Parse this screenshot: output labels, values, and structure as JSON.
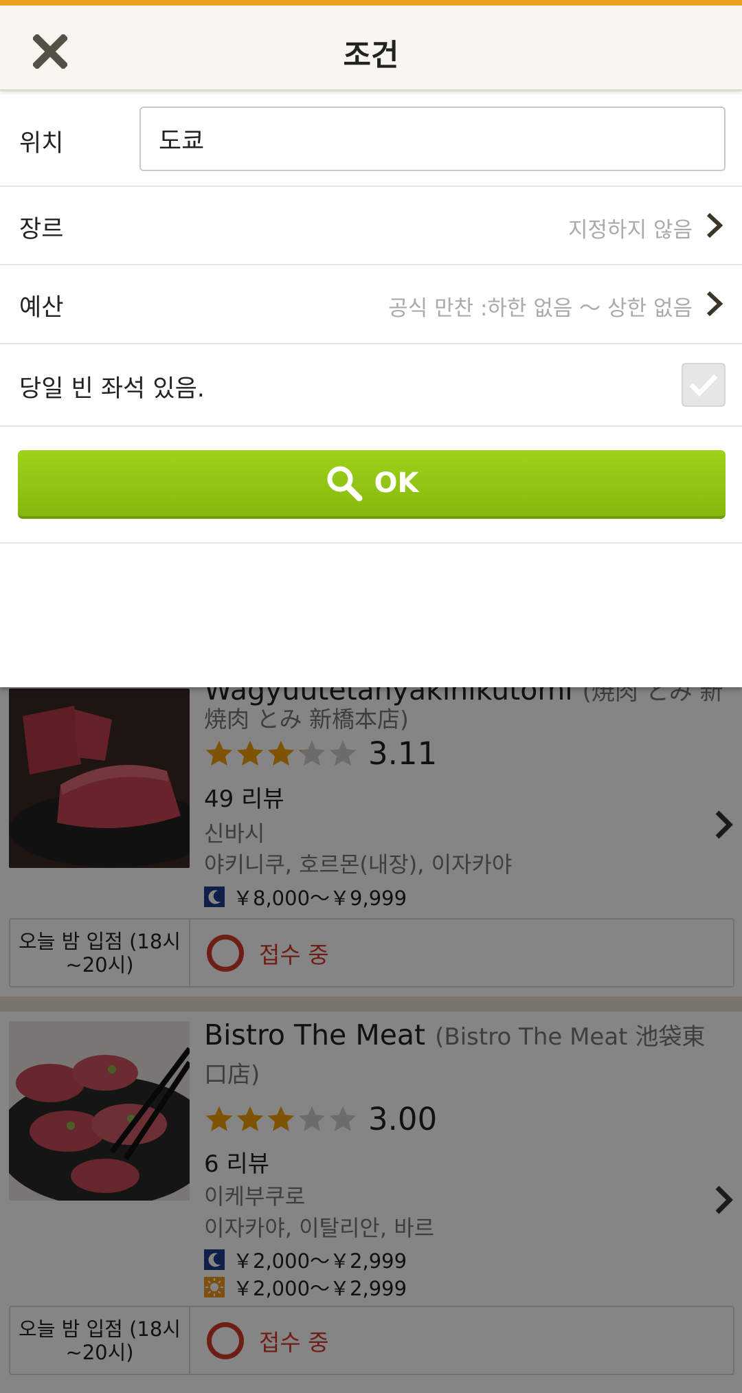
{
  "header": {
    "title": "조건"
  },
  "filters": {
    "location": {
      "label": "위치",
      "value": "도쿄"
    },
    "genre": {
      "label": "장르",
      "value": "지정하지 않음"
    },
    "budget": {
      "label": "예산",
      "value": "공식 만찬 :하한 없음 ～ 상한 없음"
    },
    "vacancy": {
      "label": "당일 빈 좌석 있음.",
      "checked": true
    },
    "ok_label": "OK"
  },
  "colors": {
    "accent": "#e8a21a",
    "ok_button": "#8fc312",
    "status_red": "#d33a2a",
    "star": "#f2a007"
  },
  "results": [
    {
      "name": "Wagyuutetanyakinikutomi",
      "alt_name": "(焼肉 とみ 新橋本店)",
      "alt_name_cont": "焼肉 とみ 新橋本店)",
      "rating": 3.11,
      "rating_text": "3.11",
      "reviews": "49 리뷰",
      "area": "신바시",
      "genre": "야키니쿠, 호르몬(내장), 이자카야",
      "dinner_price": "￥8,000～￥9,999",
      "slot_label": "오늘 밤 입점 (18시 ~20시)",
      "slot_status": "접수 중"
    },
    {
      "name": "Bistro The Meat",
      "alt_name": "(Bistro The Meat 池袋東口店)",
      "rating": 3.0,
      "rating_text": "3.00",
      "reviews": "6 리뷰",
      "area": "이케부쿠로",
      "genre": "이자카야, 이탈리안, 바르",
      "dinner_price": "￥2,000～￥2,999",
      "lunch_price": "￥2,000～￥2,999",
      "slot_label": "오늘 밤 입점 (18시 ~20시)",
      "slot_status": "접수 중"
    }
  ]
}
